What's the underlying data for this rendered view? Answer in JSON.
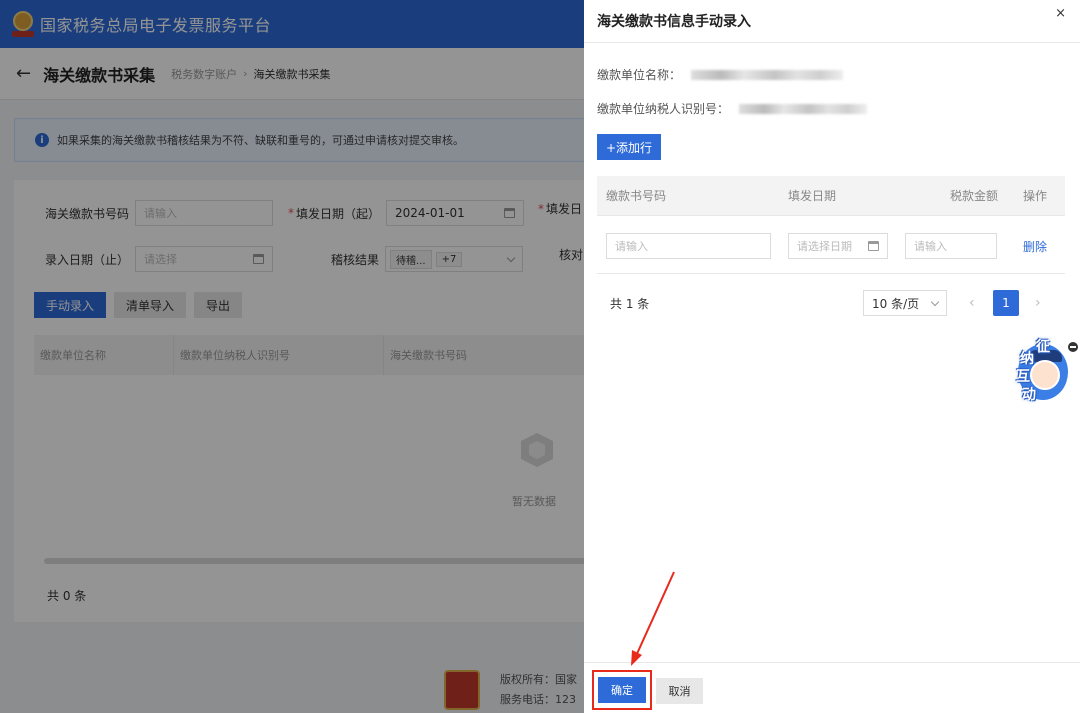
{
  "platform": {
    "title": "国家税务总局电子发票服务平台"
  },
  "page": {
    "title": "海关缴款书采集",
    "breadcrumb": [
      "税务数字账户",
      "海关缴款书采集"
    ],
    "notice": "如果采集的海关缴款书稽核结果为不符、缺联和重号的，可通过申请核对提交审核。"
  },
  "filters": {
    "customs_no_label": "海关缴款书号码",
    "customs_no_placeholder": "请输入",
    "fill_start_label": "填发日期（起）",
    "fill_start_value": "2024-01-01",
    "fill_end_label": "填发日",
    "entry_end_label": "录入日期（止）",
    "entry_end_placeholder": "请选择",
    "audit_label": "稽核结果",
    "audit_tag": "待稽...",
    "audit_more": "+7",
    "check_label": "核对"
  },
  "actions": {
    "manual": "手动录入",
    "import": "清单导入",
    "export": "导出"
  },
  "bg_table": {
    "columns": [
      "缴款单位名称",
      "缴款单位纳税人识别号",
      "海关缴款书号码"
    ],
    "empty": "暂无数据",
    "total": "共 0 条"
  },
  "footer": {
    "copyright": "版权所有：国家",
    "phone": "服务电话：123"
  },
  "drawer": {
    "title": "海关缴款书信息手动录入",
    "close": "×",
    "unit_name_label": "缴款单位名称：",
    "unit_taxid_label": "缴款单位纳税人识别号：",
    "add_row": "+添加行",
    "columns": {
      "no": "缴款书号码",
      "date": "填发日期",
      "amount": "税款金额",
      "op": "操作"
    },
    "row": {
      "no_placeholder": "请输入",
      "date_placeholder": "请选择日期",
      "amount_placeholder": "请输入",
      "delete": "删除"
    },
    "pager": {
      "total": "共 1 条",
      "page_size": "10 条/页",
      "current": "1",
      "prev": "‹",
      "next": "›"
    },
    "mascot": {
      "chars": [
        "征",
        "纳",
        "互",
        "动"
      ]
    },
    "confirm": "确定",
    "cancel": "取消"
  },
  "colors": {
    "brand": "#2e6bd8",
    "annotation": "#e8291c",
    "danger": "#e34d59"
  }
}
